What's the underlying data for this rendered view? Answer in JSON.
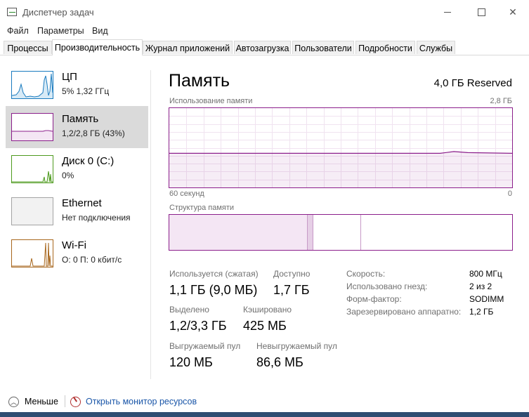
{
  "window": {
    "title": "Диспетчер задач",
    "controls": {
      "minimize": "minimize",
      "maximize": "maximize",
      "close": "✕"
    }
  },
  "menu": [
    "Файл",
    "Параметры",
    "Вид"
  ],
  "tabs": [
    {
      "label": "Процессы",
      "active": false
    },
    {
      "label": "Производительность",
      "active": true
    },
    {
      "label": "Журнал приложений",
      "active": false
    },
    {
      "label": "Автозагрузка",
      "active": false
    },
    {
      "label": "Пользователи",
      "active": false
    },
    {
      "label": "Подробности",
      "active": false
    },
    {
      "label": "Службы",
      "active": false
    }
  ],
  "sidebar": {
    "items": [
      {
        "name": "ЦП",
        "detail": "5%  1,32 ГГц",
        "color": "#1a7bbf",
        "icon": "cpu-graph-icon",
        "selected": false
      },
      {
        "name": "Память",
        "detail": "1,2/2,8 ГБ (43%)",
        "color": "#8b1e8b",
        "icon": "memory-graph-icon",
        "selected": true
      },
      {
        "name": "Диск 0 (C:)",
        "detail": "0%",
        "color": "#4d9a1e",
        "icon": "disk-graph-icon",
        "selected": false
      },
      {
        "name": "Ethernet",
        "detail": "Нет подключения",
        "color": "#a3a3a3",
        "icon": "ethernet-graph-icon",
        "selected": false
      },
      {
        "name": "Wi-Fi",
        "detail": "О: 0 П: 0 кбит/с",
        "color": "#a7661c",
        "icon": "wifi-graph-icon",
        "selected": false
      }
    ]
  },
  "main": {
    "title": "Память",
    "reserved": "4,0 ГБ Reserved",
    "usage_graph": {
      "label": "Использование памяти",
      "max_label": "2,8 ГБ",
      "time_label": "60 секунд",
      "zero_label": "0",
      "line_color": "#8b1e8b",
      "level_pct": 43
    },
    "structure": {
      "label": "Структура памяти",
      "segments_pct": {
        "in_use": 40.4,
        "modified": 1.6,
        "standby": 13.9,
        "free": 44.1
      }
    },
    "stats": {
      "used_label": "Используется (сжатая)",
      "used_value": "1,1 ГБ (9,0 МБ)",
      "available_label": "Доступно",
      "available_value": "1,7 ГБ",
      "committed_label": "Выделено",
      "committed_value": "1,2/3,3 ГБ",
      "cached_label": "Кэшировано",
      "cached_value": "425 МБ",
      "paged_label": "Выгружаемый пул",
      "paged_value": "120 МБ",
      "nonpaged_label": "Невыгружаемый пул",
      "nonpaged_value": "86,6 МБ"
    },
    "info": [
      {
        "label": "Скорость:",
        "value": "800 МГц"
      },
      {
        "label": "Использовано гнезд:",
        "value": "2 из 2"
      },
      {
        "label": "Форм-фактор:",
        "value": "SODIMM"
      },
      {
        "label": "Зарезервировано аппаратно:",
        "value": "1,2 ГБ"
      }
    ]
  },
  "footer": {
    "fewer": "Меньше",
    "resource_monitor": "Открыть монитор ресурсов"
  }
}
